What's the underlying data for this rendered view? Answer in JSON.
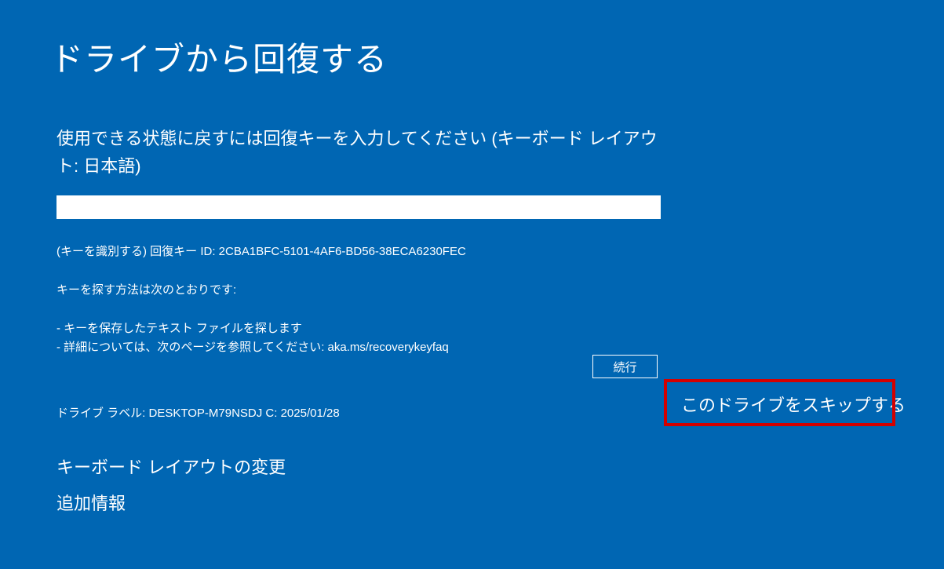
{
  "title": "ドライブから回復する",
  "prompt": "使用できる状態に戻すには回復キーを入力してください (キーボード レイアウト: 日本語)",
  "input": {
    "value": "",
    "placeholder": ""
  },
  "key_id_text": "(キーを識別する) 回復キー ID: 2CBA1BFC-5101-4AF6-BD56-38ECA6230FEC",
  "find_key_intro": "キーを探す方法は次のとおりです:",
  "help_lines": [
    "- キーを保存したテキスト ファイルを探します",
    "- 詳細については、次のページを参照してください: aka.ms/recoverykeyfaq"
  ],
  "drive_label": "ドライブ ラベル: DESKTOP-M79NSDJ C: 2025/01/28",
  "buttons": {
    "continue": "続行"
  },
  "links": {
    "change_keyboard": "キーボード レイアウトの変更",
    "more_info": "追加情報",
    "skip_drive": "このドライブをスキップする"
  }
}
